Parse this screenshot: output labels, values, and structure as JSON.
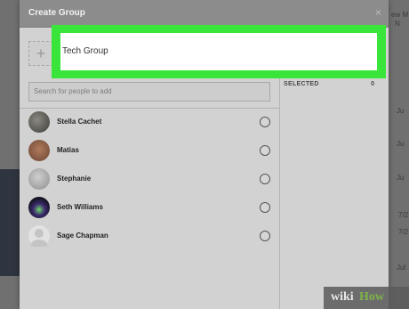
{
  "modal": {
    "title": "Create Group",
    "close_icon": "close-icon",
    "group_name_value": "Tech Group",
    "add_photo_symbol": "+",
    "search_placeholder": "Search for people to add"
  },
  "people": [
    {
      "name": "Stella Cachet",
      "avatar_color": "#4b4a46"
    },
    {
      "name": "Matias",
      "avatar_color": "#8a5a3e"
    },
    {
      "name": "Stephanie",
      "avatar_color": "#a8a8a8"
    },
    {
      "name": "Seth Williams",
      "avatar_color": "#2a1b3a"
    },
    {
      "name": "Sage Chapman",
      "avatar_color": "#b8b8b8"
    }
  ],
  "selected": {
    "label": "SELECTED",
    "count": "0"
  },
  "background_fragments": [
    "N",
    "ew M",
    "Ju",
    "Ju",
    "Ju",
    "7/2",
    "7/2",
    "Jul"
  ],
  "watermark": {
    "wiki": "wiki",
    "how": "How"
  },
  "colors": {
    "highlight": "#39e53a",
    "header": "#8c8c8c",
    "body": "#d2d2d2"
  }
}
